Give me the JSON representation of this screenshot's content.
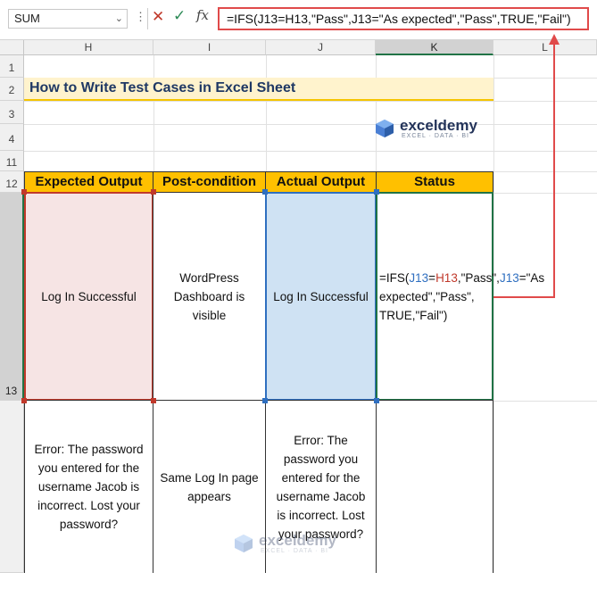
{
  "formula_bar": {
    "name_box": "SUM",
    "dots": "⋮",
    "cancel_icon": "✕",
    "enter_icon": "✓",
    "fx_label": "fx",
    "formula": "=IFS(J13=H13,\"Pass\",J13=\"As expected\",\"Pass\",TRUE,\"Fail\")"
  },
  "columns": [
    "H",
    "I",
    "J",
    "K",
    "L"
  ],
  "rows": [
    "1",
    "2",
    "3",
    "4",
    "11",
    "12",
    "13"
  ],
  "title": "How to Write Test Cases in Excel Sheet",
  "logo": {
    "name": "exceldemy",
    "tagline": "EXCEL · DATA · BI"
  },
  "table": {
    "headers": [
      "Expected Output",
      "Post-condition",
      "Actual Output",
      "Status"
    ],
    "row13": {
      "expected": "Log In Successful",
      "post": "WordPress Dashboard is visible",
      "actual": "Log In Successful",
      "status_formula": {
        "p1": "=IFS(",
        "ref1": "J13",
        "p2": "=",
        "ref2": "H13",
        "p3": ",\"Pass\",",
        "ref3": "J13",
        "p4": "=\"As expected\",\"Pass\", TRUE,\"Fail\")"
      }
    },
    "row14": {
      "expected": "Error: The password you entered for the username Jacob is incorrect. Lost your password?",
      "post": "Same Log In page appears",
      "actual": "Error: The password you entered for the username Jacob is incorrect. Lost your password?"
    }
  },
  "colors": {
    "header_fill": "#ffc000",
    "title_fill": "#fff3cd",
    "expected_fill": "#f6e4e4",
    "actual_fill": "#cfe2f3",
    "ref_blue": "#2f6fc0",
    "ref_red": "#c0392b",
    "arrow": "#e04a4a"
  }
}
